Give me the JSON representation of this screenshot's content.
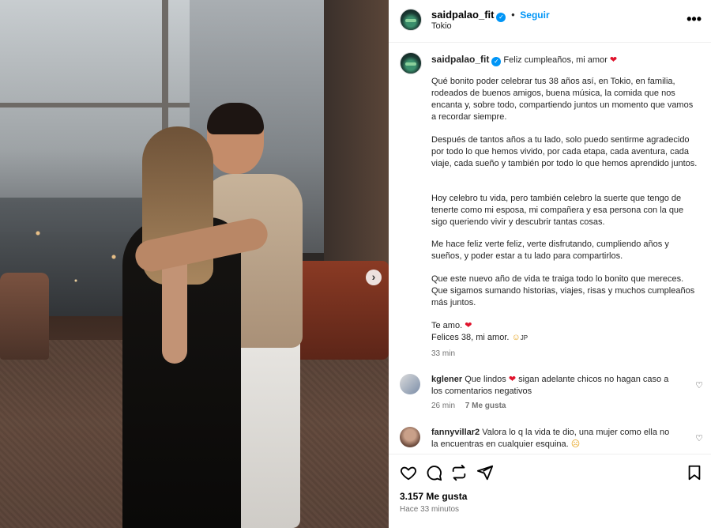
{
  "post": {
    "username": "saidpalao_fit",
    "follow_label": "Seguir",
    "location": "Tokio",
    "more_label": "•••"
  },
  "caption": {
    "username": "saidpalao_fit",
    "title": "Feliz cumpleaños, mi amor",
    "paragraphs": [
      "Qué bonito poder celebrar tus 38 años así, en Tokio, en familia, rodeados de buenos amigos, buena música, la comida que nos encanta y, sobre todo, compartiendo juntos un momento que vamos a recordar siempre.",
      "Después de tantos años a tu lado, solo puedo sentirme agradecido por todo lo que hemos vivido, por cada etapa, cada aventura, cada viaje, cada sueño y también por todo lo que hemos aprendido juntos.",
      "Hoy celebro tu vida, pero también celebro la suerte que tengo de tenerte como mi esposa, mi compañera y esa persona con la que sigo queriendo vivir y descubrir tantas cosas.",
      "Me hace feliz verte feliz, verte disfrutando, cumpliendo años y sueños, y poder estar a tu lado para compartirlos.",
      "Que este nuevo año de vida te traiga todo lo bonito que mereces. Que sigamos sumando historias, viajes, risas y muchos cumpleaños más juntos."
    ],
    "closing1": "Te amo.",
    "closing2": "Felices 38, mi amor.",
    "closing2_suffix": "JP",
    "time": "33 min"
  },
  "comments": [
    {
      "username": "kglener",
      "text_before": "Que lindos",
      "text_after": "sigan adelante chicos no hagan caso a los comentarios negativos",
      "time": "26 min",
      "likes": "7 Me gusta"
    },
    {
      "username": "fannyvillar2",
      "text": "Valora lo q la vida te dio, una mujer como ella no la encuentras en cualquier esquina."
    }
  ],
  "footer": {
    "likes": "3.157 Me gusta",
    "ago": "Hace 33 minutos"
  },
  "colors": {
    "accent": "#0095f6",
    "heart": "#e0132c"
  },
  "icons": [
    "heart-icon",
    "comment-icon",
    "repost-icon",
    "share-icon",
    "save-icon",
    "verified-icon",
    "more-icon",
    "chevron-right-icon"
  ]
}
